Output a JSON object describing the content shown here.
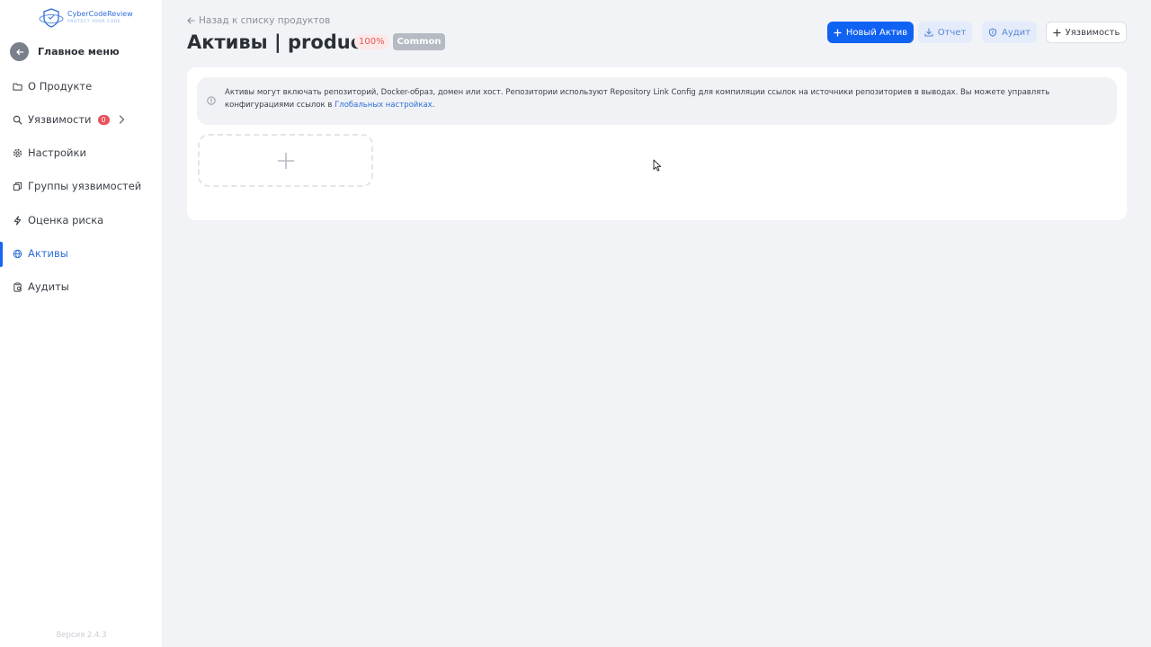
{
  "app": {
    "logo_title": "CyberCodeReview",
    "logo_tagline": "PROTECT YOUR CODE",
    "brand_color": "#1062f2"
  },
  "sidebar": {
    "main_menu_label": "Главное меню",
    "items": [
      {
        "label": "О Продукте",
        "icon": "folder-icon"
      },
      {
        "label": "Уязвимости",
        "icon": "search-icon",
        "badge": "0"
      },
      {
        "label": "Настройки",
        "icon": "gear-icon"
      },
      {
        "label": "Группы уязвимостей",
        "icon": "copy-icon"
      },
      {
        "label": "Оценка риска",
        "icon": "lightning-icon"
      },
      {
        "label": "Активы",
        "icon": "globe-icon",
        "active": true
      },
      {
        "label": "Аудиты",
        "icon": "clipboard-icon"
      }
    ],
    "version": "Версия 2.4.3"
  },
  "header": {
    "back_link": "Назад к списку продуктов",
    "title": "Активы | product",
    "percent_badge": "100%",
    "tier_badge": "Common"
  },
  "toolbar": {
    "new_asset": "Новый Актив",
    "report": "Отчет",
    "audit": "Аудит",
    "vulnerability": "Уязвимость"
  },
  "info": {
    "text": "Активы могут включать репозиторий, Docker-образ, домен или хост. Репозитории используют Repository Link Config для компиляции ссылок на источники репозиториев в выводах. Вы можете управлять конфигурациями ссылок в ",
    "link_text": "Глобальных настройках",
    "suffix": "."
  }
}
